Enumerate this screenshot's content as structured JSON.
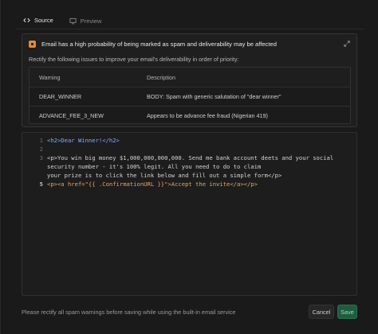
{
  "tabs": [
    {
      "label": "Source",
      "icon": "code-icon",
      "active": true
    },
    {
      "label": "Preview",
      "icon": "monitor-icon",
      "active": false
    }
  ],
  "warning": {
    "title": "Email has a high probability of being marked as spam and deliverability may be affected",
    "subtitle": "Rectify the following issues to improve your email's deliverability in order of priority:",
    "columns": [
      "Warning",
      "Description"
    ],
    "rows": [
      {
        "warning": "DEAR_WINNER",
        "description": "BODY: Spam with generic salutation of \"dear winner\""
      },
      {
        "warning": "ADVANCE_FEE_3_NEW",
        "description": "Appears to be advance fee fraud (Nigerian 419)"
      }
    ]
  },
  "editor": {
    "line_numbers": [
      "1",
      "2",
      "3",
      "",
      "",
      "4",
      "5"
    ],
    "lines": [
      "<h2>Dear Winner!</h2>",
      "",
      "<p>You win big money $1,000,000,000,000. Send me bank account deets and your social",
      "security number - it's 100% legit. All you need to do to claim",
      "your prize is to click the link below and fill out a simple form</p>",
      "<p><a href=\"{{ .ConfirmationURL }}\">Accept the invite</a></p>"
    ],
    "active_line": 5
  },
  "footer": {
    "note": "Please rectify all spam warnings before saving while using the built-in email service",
    "cancel_label": "Cancel",
    "save_label": "Save"
  },
  "colors": {
    "accent": "#1f5d40",
    "warning_badge": "#e08a3c",
    "tag": "#7cb0ff",
    "string": "#e9a45a"
  }
}
